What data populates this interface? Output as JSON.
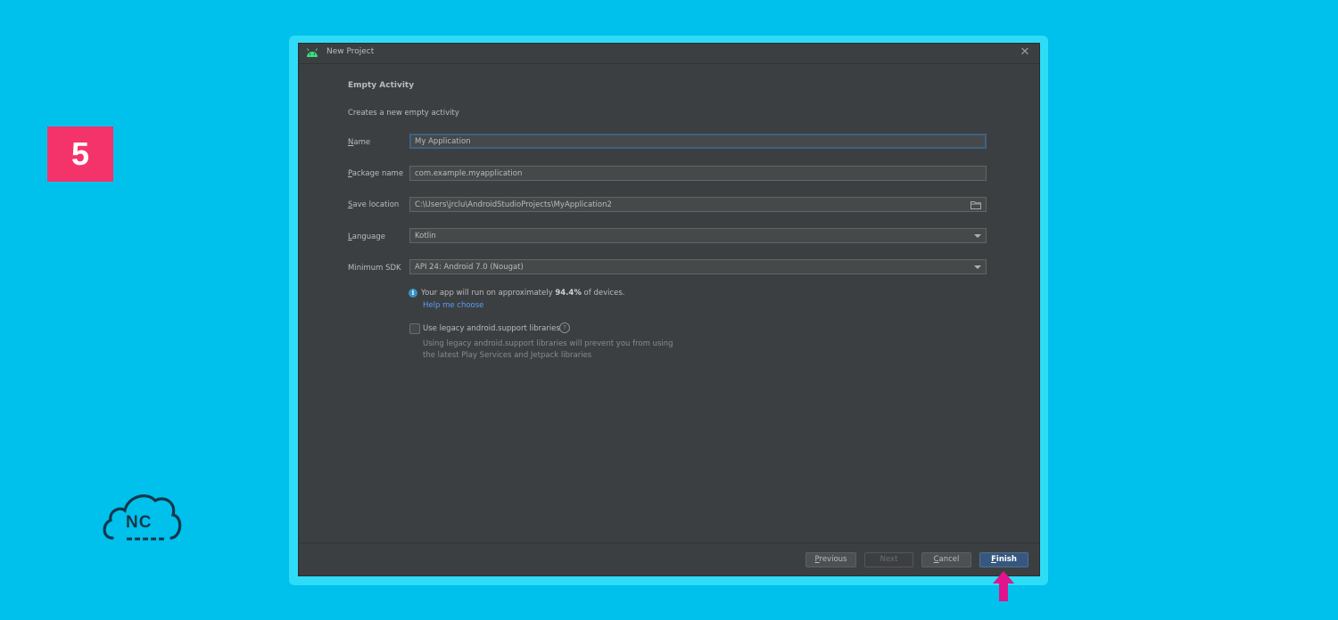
{
  "step_number": "5",
  "logo_text": "NC",
  "dialog": {
    "title": "New Project",
    "section_title": "Empty Activity",
    "section_desc": "Creates a new empty activity",
    "fields": {
      "name": {
        "label_first": "N",
        "label_rest": "ame",
        "value": "My Application"
      },
      "package": {
        "label_first": "P",
        "label_rest": "ackage name",
        "value": "com.example.myapplication"
      },
      "save_location": {
        "label_first": "S",
        "label_rest": "ave location",
        "value": "C:\\Users\\jrclu\\AndroidStudioProjects\\MyApplication2"
      },
      "language": {
        "label_first": "L",
        "label_rest": "anguage",
        "value": "Kotlin"
      },
      "min_sdk": {
        "label": "Minimum SDK",
        "value": "API 24: Android 7.0 (Nougat)"
      }
    },
    "info": {
      "prefix": "Your app will run on approximately ",
      "percent": "94.4%",
      "suffix": " of devices.",
      "help_link": "Help me choose"
    },
    "legacy": {
      "label": "Use legacy android.support libraries",
      "checked": false,
      "note_line1": "Using legacy android.support libraries will prevent you from using",
      "note_line2": "the latest Play Services and Jetpack libraries"
    },
    "buttons": {
      "previous": {
        "first": "P",
        "rest": "revious"
      },
      "next": "Next",
      "cancel": {
        "first": "C",
        "rest": "ancel"
      },
      "finish": {
        "first": "F",
        "rest": "inish"
      }
    }
  },
  "colors": {
    "background": "#00c0ec",
    "badge": "#f5336b",
    "dialog_bg": "#3c3f41",
    "primary_button": "#365880",
    "arrow": "#e0148c"
  }
}
